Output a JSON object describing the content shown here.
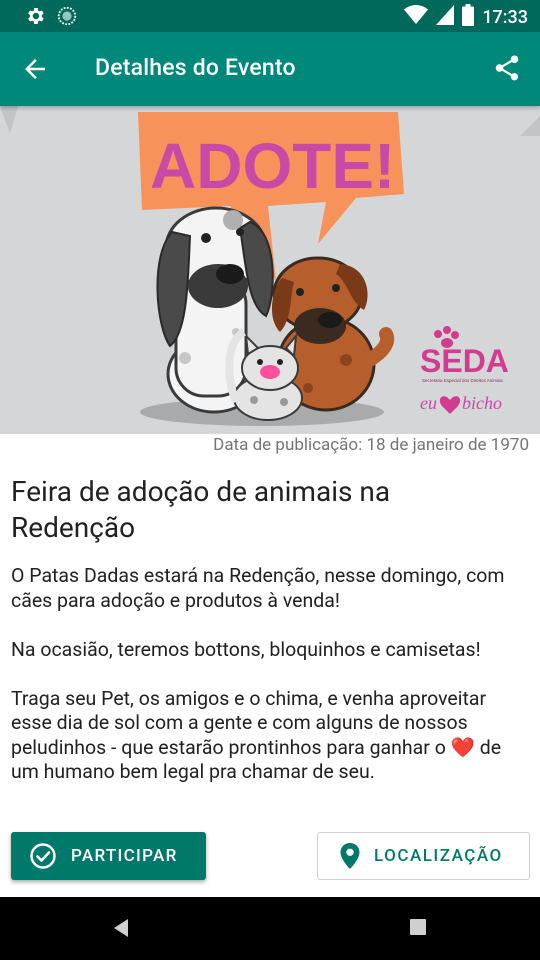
{
  "status_bar": {
    "time": "17:33",
    "icons": [
      "gear-icon",
      "sync-icon",
      "wifi-icon",
      "signal-icon",
      "battery-icon"
    ]
  },
  "app_bar": {
    "title": "Detalhes do Evento",
    "back_icon": "arrow-back-icon",
    "share_icon": "share-icon"
  },
  "banner": {
    "headline": "ADOTE!",
    "logo_text": "SEDA",
    "logo_subtitle": "Secretaria Especial dos Direitos Animais",
    "tagline_left": "eu",
    "tagline_right": "bicho"
  },
  "publication": "Data de publicação: 18 de janeiro de 1970",
  "event": {
    "title": "Feira de adoção de animais na Redenção",
    "paragraphs": [
      "O Patas Dadas estará na Redenção, nesse domingo, com cães para adoção e produtos à venda!",
      "Na ocasião, teremos bottons, bloquinhos e camisetas!",
      "Traga seu Pet, os amigos e o chima, e venha aproveitar esse dia de sol com a gente e com alguns de nossos peludinhos - que estarão prontinhos para ganhar o ❤️ de um humano bem legal pra chamar de seu."
    ]
  },
  "actions": {
    "participar": "PARTICIPAR",
    "localizacao": "LOCALIZAÇÃO"
  },
  "colors": {
    "primary": "#00897b",
    "primary_dark": "#00695c",
    "accent_orange": "#f7935a",
    "headline_pink": "#c94aa6"
  }
}
